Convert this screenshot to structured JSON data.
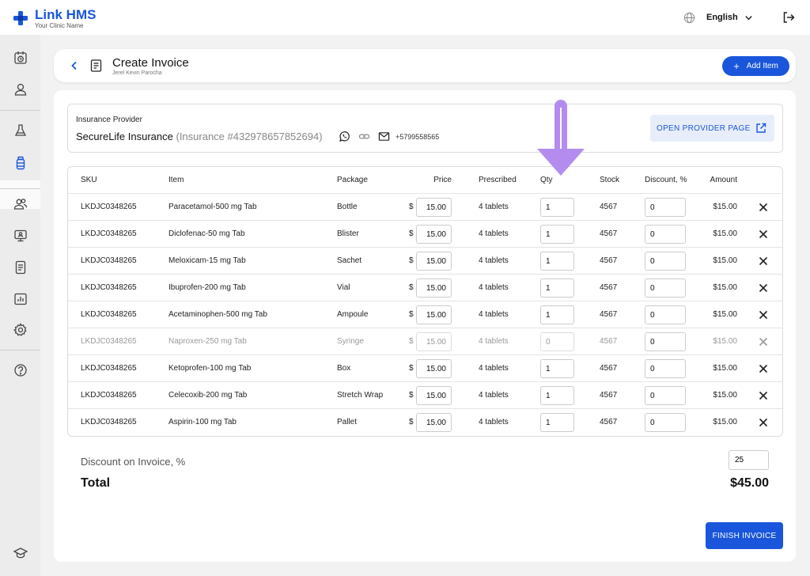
{
  "app": {
    "title": "Link HMS",
    "subtitle": "Your Clinic Name",
    "language": "English"
  },
  "colors": {
    "accent": "#1a56db",
    "annotation_arrow": "#b48cf0"
  },
  "sidebar": {
    "items": [
      {
        "icon": "calendar-clock-icon"
      },
      {
        "icon": "user-icon"
      },
      {
        "icon": "flask-icon"
      },
      {
        "icon": "medicine-bottle-icon",
        "active": true
      },
      {
        "icon": "users-icon"
      },
      {
        "icon": "monitor-icon"
      },
      {
        "icon": "document-icon"
      },
      {
        "icon": "chart-icon"
      },
      {
        "icon": "gear-icon"
      },
      {
        "icon": "help-icon"
      },
      {
        "icon": "graduation-cap-icon"
      }
    ]
  },
  "header": {
    "title": "Create Invoice",
    "subtitle": "Jerel Kevin Parocha",
    "add_label": "Add Item"
  },
  "insurance": {
    "label": "Insurance Provider",
    "name": "SecureLife Insurance",
    "number": "(Insurance #432978657852694)",
    "phone": "+5799558565",
    "open_label": "OPEN PROVIDER PAGE"
  },
  "table": {
    "columns": {
      "sku": "SKU",
      "item": "Item",
      "package": "Package",
      "price": "Price",
      "prescribed": "Prescribed",
      "qty": "Qty",
      "stock": "Stock",
      "discount": "Discount, %",
      "amount": "Amount"
    },
    "currency": "$",
    "rows": [
      {
        "sku": "LKDJC0348265",
        "item": "Paracetamol-500 mg Tab",
        "package": "Bottle",
        "price": "15.00",
        "prescribed": "4 tablets",
        "qty": "1",
        "stock": "4567",
        "discount": "0",
        "amount": "$15.00"
      },
      {
        "sku": "LKDJC0348265",
        "item": "Diclofenac-50 mg Tab",
        "package": "Blister",
        "price": "15.00",
        "prescribed": "4 tablets",
        "qty": "1",
        "stock": "4567",
        "discount": "0",
        "amount": "$15.00"
      },
      {
        "sku": "LKDJC0348265",
        "item": "Meloxicam-15 mg Tab",
        "package": "Sachet",
        "price": "15.00",
        "prescribed": "4 tablets",
        "qty": "1",
        "stock": "4567",
        "discount": "0",
        "amount": "$15.00"
      },
      {
        "sku": "LKDJC0348265",
        "item": "Ibuprofen-200 mg Tab",
        "package": "Vial",
        "price": "15.00",
        "prescribed": "4 tablets",
        "qty": "1",
        "stock": "4567",
        "discount": "0",
        "amount": "$15.00"
      },
      {
        "sku": "LKDJC0348265",
        "item": "Acetaminophen-500 mg Tab",
        "package": "Ampoule",
        "price": "15.00",
        "prescribed": "4 tablets",
        "qty": "1",
        "stock": "4567",
        "discount": "0",
        "amount": "$15.00"
      },
      {
        "sku": "LKDJC0348265",
        "item": "Naproxen-250 mg Tab",
        "package": "Syringe",
        "price": "15.00",
        "prescribed": "4 tablets",
        "qty": "0",
        "stock": "4567",
        "discount": "0",
        "amount": "$15.00",
        "disabled": true
      },
      {
        "sku": "LKDJC0348265",
        "item": "Ketoprofen-100 mg Tab",
        "package": "Box",
        "price": "15.00",
        "prescribed": "4 tablets",
        "qty": "1",
        "stock": "4567",
        "discount": "0",
        "amount": "$15.00"
      },
      {
        "sku": "LKDJC0348265",
        "item": "Celecoxib-200 mg Tab",
        "package": "Stretch Wrap",
        "price": "15.00",
        "prescribed": "4 tablets",
        "qty": "1",
        "stock": "4567",
        "discount": "0",
        "amount": "$15.00"
      },
      {
        "sku": "LKDJC0348265",
        "item": "Aspirin-100 mg Tab",
        "package": "Pallet",
        "price": "15.00",
        "prescribed": "4 tablets",
        "qty": "1",
        "stock": "4567",
        "discount": "0",
        "amount": "$15.00"
      }
    ]
  },
  "summary": {
    "discount_label": "Discount on Invoice, %",
    "discount_value": "25",
    "total_label": "Total",
    "total_value": "$45.00"
  },
  "actions": {
    "finish_label": "FINISH INVOICE"
  }
}
